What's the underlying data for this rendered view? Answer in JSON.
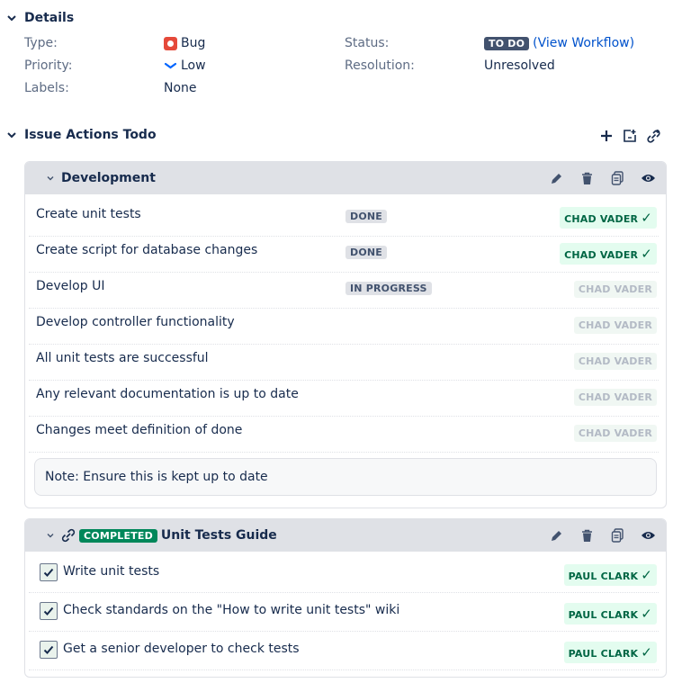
{
  "details": {
    "title": "Details",
    "type_label": "Type:",
    "type_value": "Bug",
    "priority_label": "Priority:",
    "priority_value": "Low",
    "labels_label": "Labels:",
    "labels_value": "None",
    "status_label": "Status:",
    "status_value": "TO DO",
    "workflow_open": "(",
    "workflow_link": "View Workflow",
    "workflow_close": ")",
    "resolution_label": "Resolution:",
    "resolution_value": "Unresolved"
  },
  "actions": {
    "title": "Issue Actions Todo",
    "icons": [
      "plus-icon",
      "add-from-template-icon",
      "link-add-icon"
    ]
  },
  "development": {
    "title": "Development",
    "rows": [
      {
        "text": "Create unit tests",
        "status": "DONE",
        "assignee": "CHAD VADER",
        "done": true
      },
      {
        "text": "Create script for database changes",
        "status": "DONE",
        "assignee": "CHAD VADER",
        "done": true
      },
      {
        "text": "Develop UI",
        "status": "IN PROGRESS",
        "assignee": "CHAD VADER",
        "done": false
      },
      {
        "text": "Develop controller functionality",
        "status": "",
        "assignee": "CHAD VADER",
        "done": false
      },
      {
        "text": "All unit tests are successful",
        "status": "",
        "assignee": "CHAD VADER",
        "done": false
      },
      {
        "text": "Any relevant documentation is up to date",
        "status": "",
        "assignee": "CHAD VADER",
        "done": false
      },
      {
        "text": "Changes meet definition of done",
        "status": "",
        "assignee": "CHAD VADER",
        "done": false
      }
    ],
    "note": "Note: Ensure this is kept up to date"
  },
  "unit_tests": {
    "badge": "COMPLETED",
    "title": "Unit Tests Guide",
    "rows": [
      {
        "text": "Write unit tests",
        "assignee": "PAUL CLARK",
        "checked": true
      },
      {
        "text": "Check standards on the \"How to write unit tests\" wiki",
        "assignee": "PAUL CLARK",
        "checked": true
      },
      {
        "text": "Get a senior developer to check tests",
        "assignee": "PAUL CLARK",
        "checked": true
      }
    ]
  },
  "checkmark": "✓",
  "colors": {
    "bug": "#e5493a",
    "priority_low": "#0065ff",
    "link": "#0052cc",
    "done_green": "#006644",
    "panel_header": "#dfe1e6"
  }
}
